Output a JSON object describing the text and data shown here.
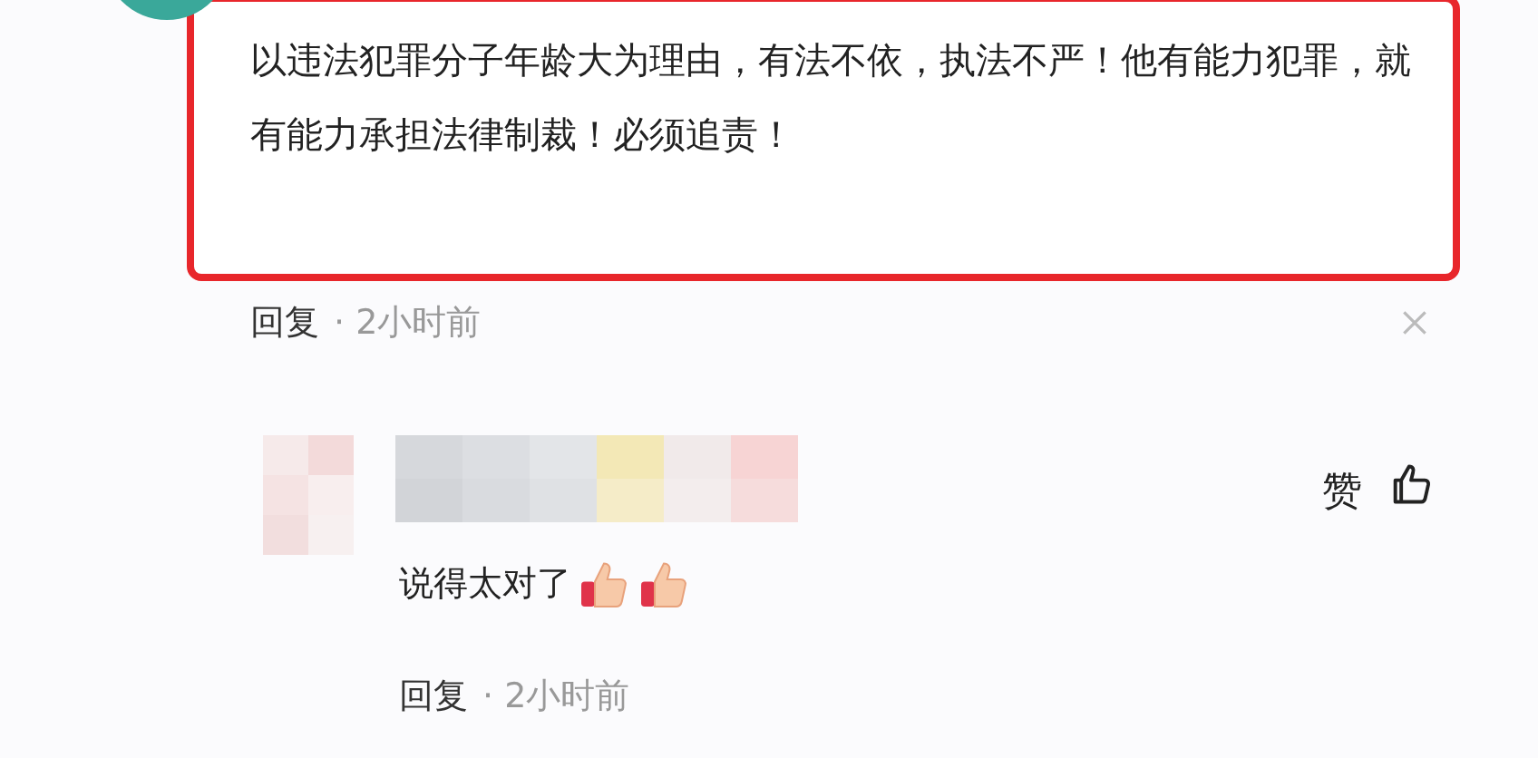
{
  "comments": [
    {
      "kind": "boxed",
      "text": "以违法犯罪分子年龄大为理由，有法不依，执法不严！他有能力犯罪，就有能力承担法律制裁！必须追责！",
      "reply": "回复",
      "time": "· 2小时前"
    },
    {
      "kind": "reply",
      "text": "说得太对了",
      "emoji": [
        {
          "kind": "thumbs-up"
        },
        {
          "kind": "thumbs-up"
        }
      ],
      "like": "赞",
      "reply": "回复",
      "time": "· 2小时前"
    }
  ]
}
